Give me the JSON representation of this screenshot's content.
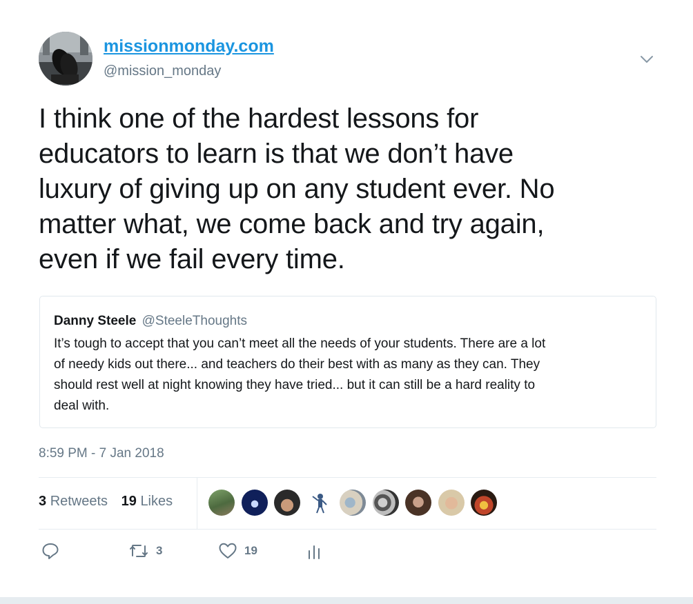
{
  "author": {
    "display_name": "missionmonday.com",
    "handle": "@mission_monday",
    "avatar_icon": "avatar-feet-on-desk"
  },
  "tweet": {
    "text_lines": [
      "I think one of the hardest lessons for",
      "educators to learn is that we don’t have",
      "luxury of giving up on any student ever. No",
      "matter what, we come back and try again,",
      "even if we fail every time."
    ],
    "timestamp": "8:59 PM - 7 Jan 2018"
  },
  "quoted": {
    "name": "Danny Steele",
    "handle": "@SteeleThoughts",
    "text_lines": [
      "It’s tough to accept that you can’t meet all the needs of your students. There are a lot",
      "of needy kids out there... and teachers do their best with as many as they can. They",
      "should rest well at night knowing they have tried... but it can still be a hard reality to",
      "deal with."
    ]
  },
  "stats": {
    "retweets_count": "3",
    "retweets_label": "Retweets",
    "likes_count": "19",
    "likes_label": "Likes"
  },
  "actions": {
    "reply_icon": "reply-icon",
    "retweet_icon": "retweet-icon",
    "retweet_count": "3",
    "like_icon": "heart-icon",
    "like_count": "19",
    "analytics_icon": "analytics-icon"
  },
  "colors": {
    "link": "#1b95e0",
    "muted": "#657786",
    "text": "#14171a",
    "border": "#e1e8ed"
  }
}
